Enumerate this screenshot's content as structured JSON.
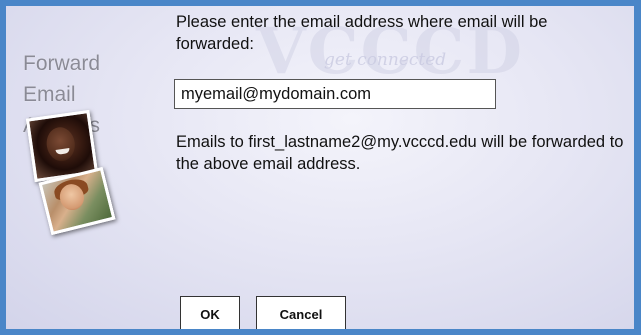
{
  "sidebar": {
    "title": "Forward Email Address"
  },
  "watermark": {
    "logo_text": "VCCCD",
    "tagline": "get connected"
  },
  "form": {
    "prompt": "Please enter the email address where email will be forwarded:",
    "email_value": "myemail@mydomain.com",
    "info_text": "Emails to first_lastname2@my.vcccd.edu will be forwarded to the above email address."
  },
  "buttons": {
    "ok_label": "OK",
    "cancel_label": "Cancel"
  },
  "colors": {
    "frame_border": "#4a86c8",
    "panel_background": "#e6e6f4",
    "sidebar_title": "#8a8a96"
  },
  "icons": [
    "student-photo-1",
    "student-photo-2"
  ]
}
